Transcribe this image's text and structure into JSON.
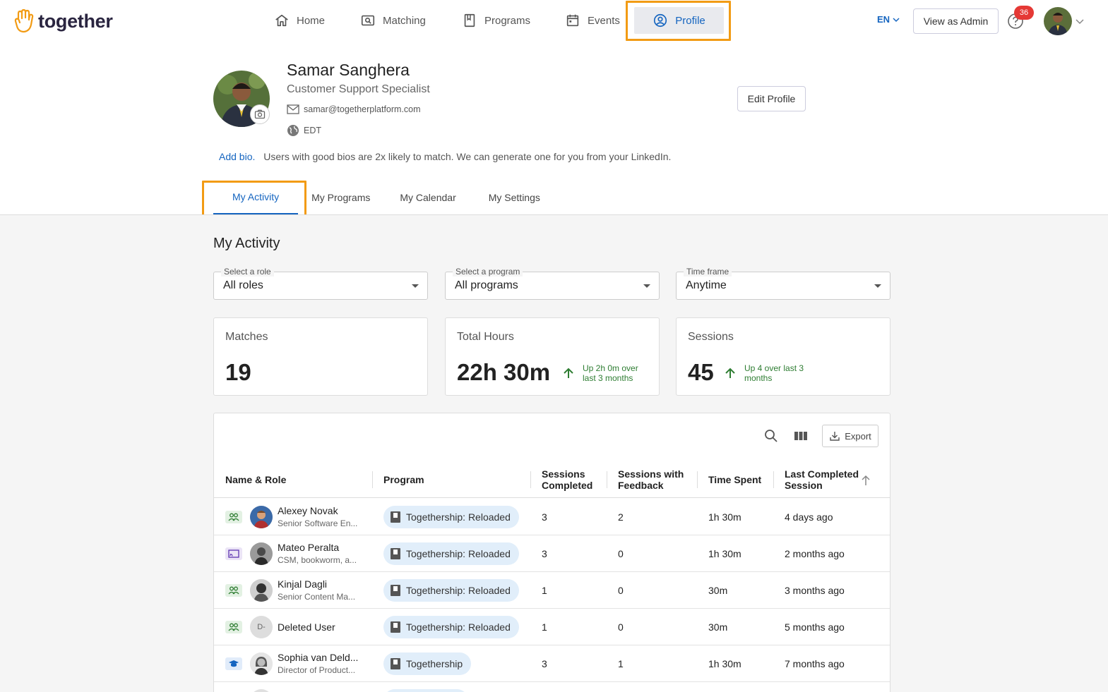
{
  "brand": {
    "name": "together",
    "accent": "#f29b14",
    "primary": "#1565c0"
  },
  "nav": {
    "items": [
      {
        "label": "Home",
        "icon": "home-icon"
      },
      {
        "label": "Matching",
        "icon": "matching-icon"
      },
      {
        "label": "Programs",
        "icon": "book-icon"
      },
      {
        "label": "Events",
        "icon": "calendar-icon"
      },
      {
        "label": "Profile",
        "icon": "user-circle-icon"
      }
    ],
    "active": "Profile",
    "language": "EN",
    "view_admin": "View as Admin",
    "notification_count": "36"
  },
  "profile": {
    "name": "Samar Sanghera",
    "title": "Customer Support Specialist",
    "email": "samar@togetherplatform.com",
    "timezone": "EDT",
    "edit_label": "Edit Profile",
    "add_bio": "Add bio.",
    "bio_hint": "Users with good bios are 2x likely to match. We can generate one for you from your LinkedIn."
  },
  "tabs": [
    "My Activity",
    "My Programs",
    "My Calendar",
    "My Settings"
  ],
  "activity": {
    "title": "My Activity",
    "filters": [
      {
        "label": "Select a role",
        "value": "All roles"
      },
      {
        "label": "Select a program",
        "value": "All programs"
      },
      {
        "label": "Time frame",
        "value": "Anytime"
      }
    ],
    "stats": [
      {
        "label": "Matches",
        "value": "19",
        "trend": ""
      },
      {
        "label": "Total Hours",
        "value": "22h 30m",
        "trend_line1": "Up 2h 0m over",
        "trend_line2": "last 3 months"
      },
      {
        "label": "Sessions",
        "value": "45",
        "trend_line1": "Up 4 over last 3",
        "trend_line2": "months"
      }
    ],
    "export_label": "Export",
    "columns": {
      "name_role": "Name & Role",
      "program": "Program",
      "sessions_completed_1": "Sessions",
      "sessions_completed_2": "Completed",
      "sessions_feedback_1": "Sessions with",
      "sessions_feedback_2": "Feedback",
      "time_spent": "Time Spent",
      "last_completed_1": "Last Completed",
      "last_completed_2": "Session"
    },
    "rows": [
      {
        "role": "peer",
        "name": "Alexey Novak",
        "sub": "Senior Software En...",
        "program": "Togethership: Reloaded",
        "completed": "3",
        "feedback": "2",
        "time": "1h 30m",
        "last": "4 days ago"
      },
      {
        "role": "cast",
        "name": "Mateo Peralta",
        "sub": "CSM, bookworm, a...",
        "program": "Togethership: Reloaded",
        "completed": "3",
        "feedback": "0",
        "time": "1h 30m",
        "last": "2 months ago"
      },
      {
        "role": "peer",
        "name": "Kinjal Dagli",
        "sub": "Senior Content Ma...",
        "program": "Togethership: Reloaded",
        "completed": "1",
        "feedback": "0",
        "time": "30m",
        "last": "3 months ago"
      },
      {
        "role": "peer",
        "name": "Deleted User",
        "sub": "",
        "initials": "D-",
        "program": "Togethership: Reloaded",
        "completed": "1",
        "feedback": "0",
        "time": "30m",
        "last": "5 months ago"
      },
      {
        "role": "grad",
        "name": "Sophia van Deld...",
        "sub": "Director of Product...",
        "program": "Togethership",
        "completed": "3",
        "feedback": "1",
        "time": "1h 30m",
        "last": "7 months ago"
      }
    ]
  }
}
